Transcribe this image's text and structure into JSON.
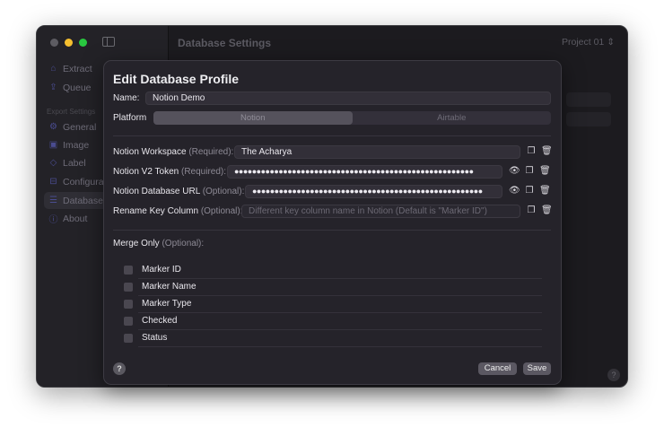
{
  "window": {
    "title": "Database Settings",
    "project": "Project 01",
    "project_icon": "chevron-up-down-icon",
    "help": "?"
  },
  "sidebar": {
    "items": [
      {
        "label": "Extract",
        "icon": "house-icon"
      },
      {
        "label": "Queue",
        "icon": "tray-upload-icon"
      }
    ],
    "section": "Export Settings",
    "settings": [
      {
        "label": "General",
        "icon": "gear-icon"
      },
      {
        "label": "Image",
        "icon": "photo-icon"
      },
      {
        "label": "Label",
        "icon": "tag-icon"
      },
      {
        "label": "Configurations",
        "icon": "briefcase-icon"
      },
      {
        "label": "Databases",
        "icon": "table-icon",
        "selected": true
      },
      {
        "label": "About",
        "icon": "info-icon"
      }
    ]
  },
  "modal": {
    "title": "Edit Database Profile",
    "name_label": "Name:",
    "name_value": "Notion Demo",
    "platform_label": "Platform",
    "platforms": [
      "Notion",
      "Airtable"
    ],
    "platform_selected": "Notion",
    "workspace": {
      "label": "Notion Workspace",
      "hint": "(Required):",
      "value": "The Acharya"
    },
    "token": {
      "label": "Notion V2 Token",
      "hint": "(Required):",
      "value": "●●●●●●●●●●●●●●●●●●●●●●●●●●●●●●●●●●●●●●●●●●●●●●●●●●●●●●"
    },
    "url": {
      "label": "Notion Database URL",
      "hint": "(Optional):",
      "value": "●●●●●●●●●●●●●●●●●●●●●●●●●●●●●●●●●●●●●●●●●●●●●●●●●●●●"
    },
    "rename": {
      "label": "Rename Key Column",
      "hint": "(Optional):",
      "placeholder": "Different key column name in Notion (Default is \"Marker ID\")"
    },
    "merge_label": "Merge Only",
    "merge_hint": "(Optional):",
    "merge_options": [
      {
        "label": "Marker ID",
        "checked": false
      },
      {
        "label": "Marker Name",
        "checked": false
      },
      {
        "label": "Marker Type",
        "checked": false
      },
      {
        "label": "Checked",
        "checked": false
      },
      {
        "label": "Status",
        "checked": false
      }
    ],
    "help": "?",
    "cancel": "Cancel",
    "save": "Save"
  },
  "icons": {
    "eye": "👁",
    "copy": "❐",
    "trash": "🗑"
  }
}
